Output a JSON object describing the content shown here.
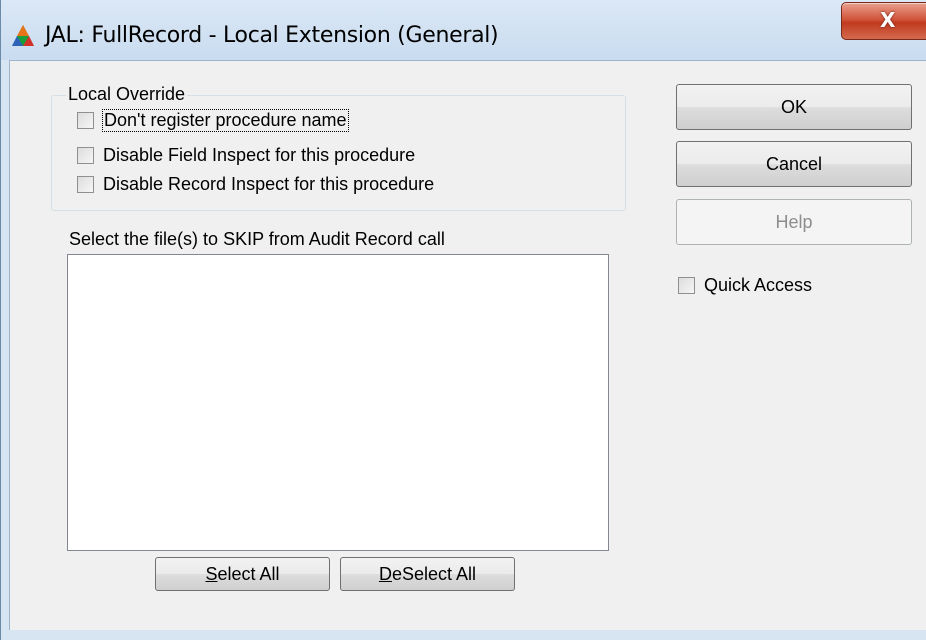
{
  "window": {
    "title": "JAL: FullRecord - Local Extension (General)",
    "close_label": "X"
  },
  "local_override": {
    "group_label": "Local Override",
    "options": [
      {
        "label": "Don't register procedure name",
        "checked": false,
        "focused": true
      },
      {
        "label": "Disable Field Inspect for this procedure",
        "checked": false
      },
      {
        "label": "Disable Record Inspect for this procedure",
        "checked": false
      }
    ]
  },
  "file_list": {
    "label": "Select the file(s) to SKIP from Audit Record call",
    "items": []
  },
  "buttons": {
    "ok": "OK",
    "cancel": "Cancel",
    "help": "Help",
    "select_all_mnemonic": "S",
    "select_all_rest": "elect All",
    "deselect_all_mnemonic": "D",
    "deselect_all_rest": "eSelect All"
  },
  "quick_access": {
    "label": "Quick Access",
    "checked": false
  },
  "colors": {
    "titlebar": "#c9dcf0",
    "close_button": "#c8452a",
    "dialog_bg": "#f0f0f0",
    "disabled_text": "#8d8d8d"
  }
}
